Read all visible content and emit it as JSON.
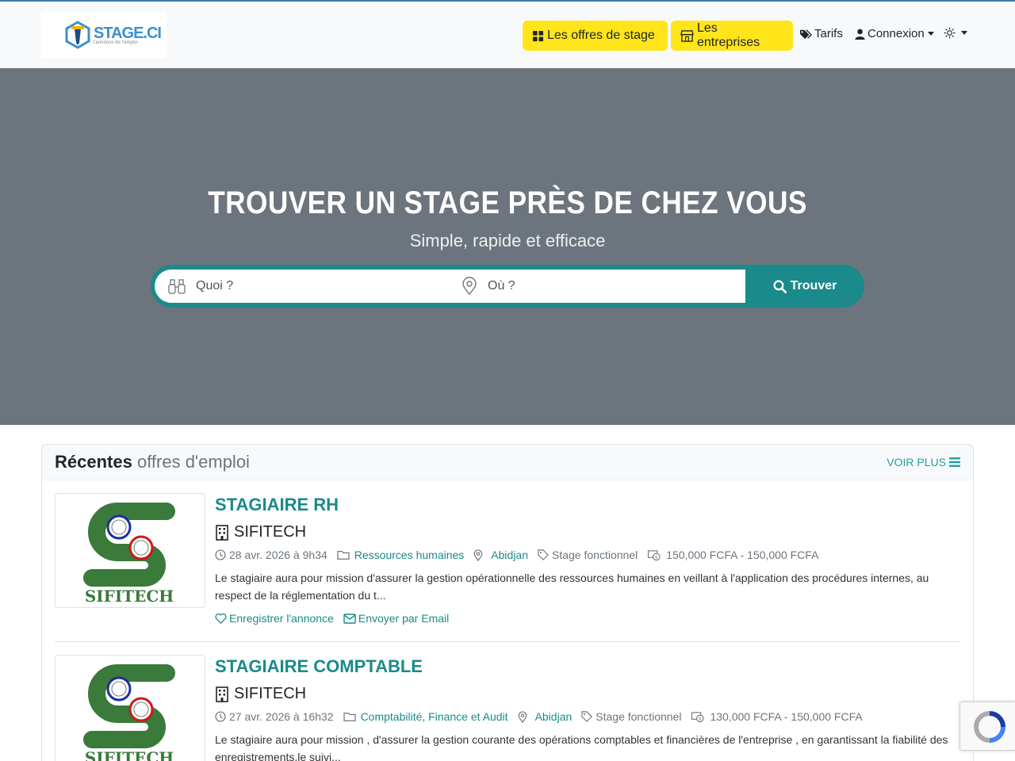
{
  "nav": {
    "logo_text": "STAGE.CI",
    "logo_tagline": "l'annonce de l'emploi",
    "offers_label": "Les offres de stage",
    "companies_label": "Les entreprises",
    "pricing_label": "Tarifs",
    "login_label": "Connexion",
    "accent_color": "#ffe51a"
  },
  "hero": {
    "title": "TROUVER UN STAGE PRÈS DE CHEZ VOUS",
    "subtitle": "Simple, rapide et efficace",
    "what_placeholder": "Quoi ?",
    "where_placeholder": "Où ?",
    "search_button": "Trouver"
  },
  "recent": {
    "title_bold": "Récentes",
    "title_light": " offres d'emploi",
    "more_label": "VOIR PLUS",
    "jobs": [
      {
        "title": "STAGIAIRE RH",
        "company": "SIFITECH",
        "date": "28 avr. 2026 à 9h34",
        "category": "Ressources humaines",
        "location": "Abidjan",
        "type": "Stage fonctionnel",
        "salary": "150,000 FCFA - 150,000 FCFA",
        "description": "Le stagiaire aura pour mission d'assurer la gestion opérationnelle des ressources humaines en veillant à l'application des procédures internes, au respect de la réglementation du t...",
        "save_label": "Enregistrer l'annonce",
        "email_label": "Envoyer par Email",
        "logo_text": "SIFITECH"
      },
      {
        "title": "STAGIAIRE COMPTABLE",
        "company": "SIFITECH",
        "date": "27 avr. 2026 à 16h32",
        "category": "Comptabilité, Finance et Audit",
        "location": "Abidjan",
        "type": "Stage fonctionnel",
        "salary": "130,000 FCFA - 150,000 FCFA",
        "description": "Le stagiaire aura pour mission , d'assurer la gestion courante des opérations comptables et financières de l'entreprise , en garantissant la fiabilité des enregistrements,le suivi...",
        "logo_text": "SIFITECH"
      }
    ]
  }
}
